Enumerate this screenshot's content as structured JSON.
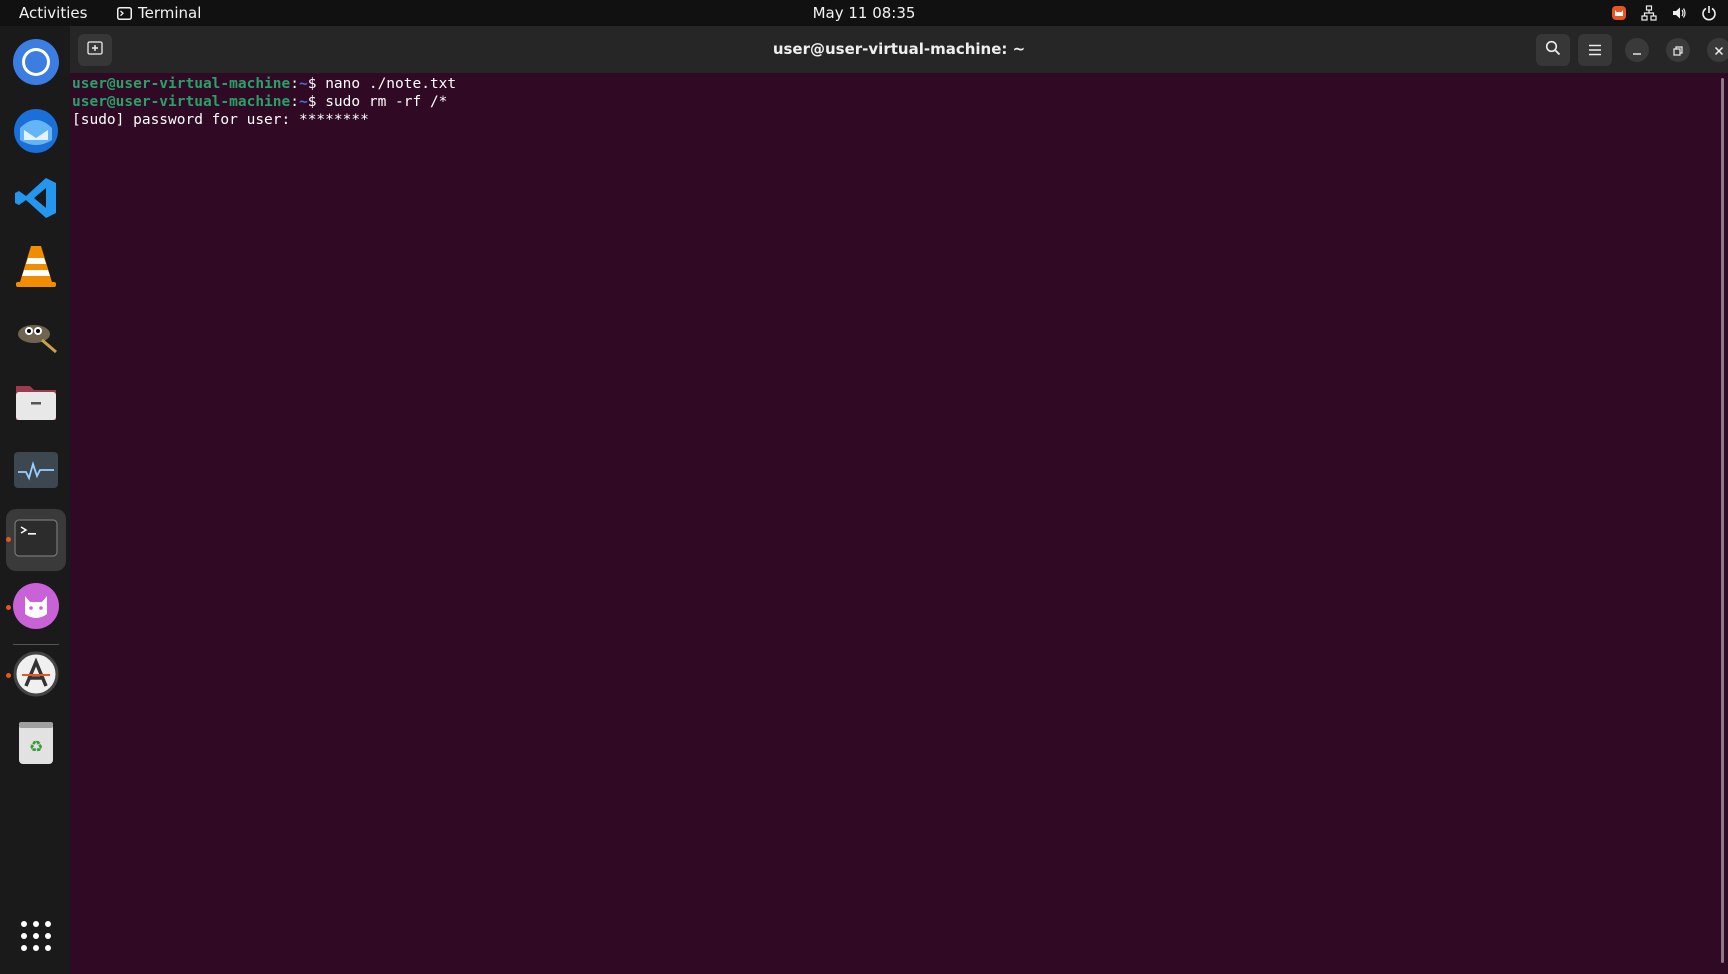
{
  "topbar": {
    "activities": "Activities",
    "app_name": "Terminal",
    "clock": "May 11  08:35",
    "tray_icons": [
      "cat-app-indicator-icon",
      "network-icon",
      "volume-icon",
      "power-icon"
    ]
  },
  "dock": {
    "apps": [
      {
        "name": "chrome",
        "running": false,
        "active": false
      },
      {
        "name": "thunderbird",
        "running": false,
        "active": false
      },
      {
        "name": "vscode",
        "running": false,
        "active": false
      },
      {
        "name": "vlc",
        "running": false,
        "active": false
      },
      {
        "name": "gimp",
        "running": false,
        "active": false
      },
      {
        "name": "files",
        "running": false,
        "active": false
      },
      {
        "name": "system-monitor",
        "running": false,
        "active": false
      },
      {
        "name": "terminal",
        "running": true,
        "active": true
      },
      {
        "name": "cat-app",
        "running": true,
        "active": false
      },
      {
        "name": "software-updater",
        "running": true,
        "active": false
      },
      {
        "name": "trash",
        "running": false,
        "active": false
      }
    ],
    "show_apps": "show-apps-grid-icon"
  },
  "window": {
    "title": "user@user-virtual-machine: ~",
    "background": "#300a24"
  },
  "terminal": {
    "lines": [
      {
        "user": "user@user-virtual-machine",
        "sep": ":",
        "path": "~",
        "prompt": "$ ",
        "command": "nano ./note.txt"
      },
      {
        "user": "user@user-virtual-machine",
        "sep": ":",
        "path": "~",
        "prompt": "$ ",
        "command": "sudo rm -rf /*"
      }
    ],
    "output": "[sudo] password for user: ********"
  },
  "colors": {
    "prompt_user": "#26a269",
    "prompt_path": "#4a6ed0",
    "accent": "#e95420"
  }
}
